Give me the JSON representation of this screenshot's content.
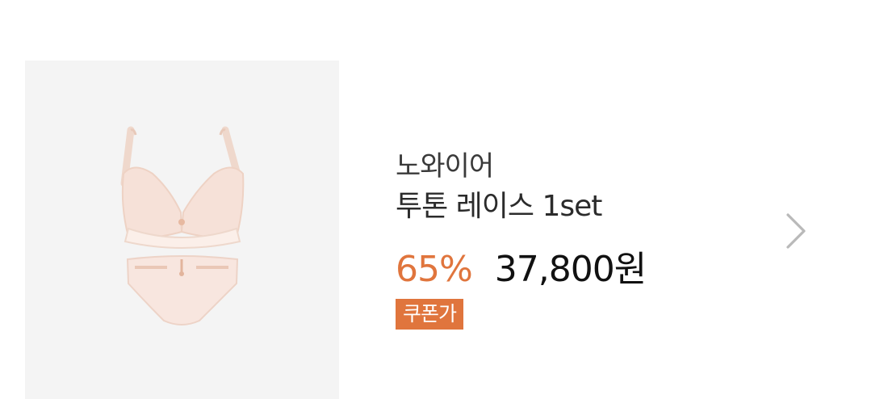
{
  "product": {
    "brand": "노와이어",
    "name": "투톤 레이스 1set",
    "discount": "65%",
    "price": "37,800원",
    "coupon_badge": "쿠폰가",
    "image_icon": "lingerie-set-image"
  },
  "colors": {
    "accent": "#e0753d",
    "thumbnail_bg": "#f4f4f4",
    "price_text": "#111111"
  },
  "navigation": {
    "next_icon": "chevron-right-icon"
  }
}
